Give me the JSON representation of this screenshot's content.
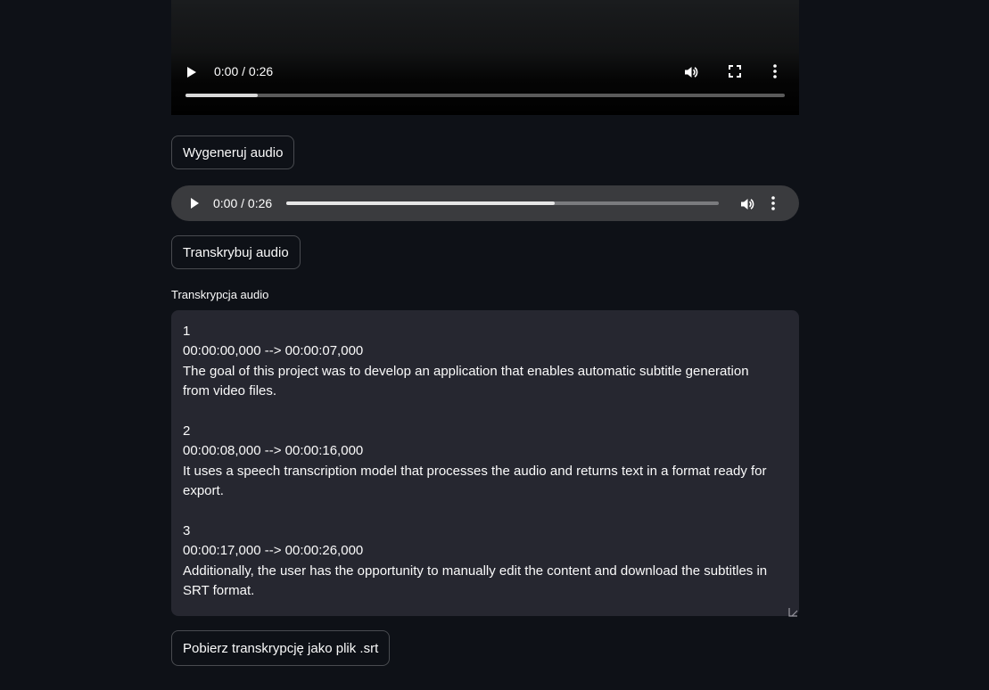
{
  "video_player": {
    "time": "0:00 / 0:26",
    "progress": 0.12
  },
  "generate_button": {
    "label": "Wygeneruj audio"
  },
  "audio_player": {
    "time": "0:00 / 0:26",
    "progress": 0.62
  },
  "transcribe_button": {
    "label": "Transkrybuj audio"
  },
  "transcription": {
    "label": "Transkrypcja audio",
    "value": "1\n00:00:00,000 --> 00:00:07,000\nThe goal of this project was to develop an application that enables automatic subtitle generation from video files.\n\n2\n00:00:08,000 --> 00:00:16,000\nIt uses a speech transcription model that processes the audio and returns text in a format ready for export.\n\n3\n00:00:17,000 --> 00:00:26,000\nAdditionally, the user has the opportunity to manually edit the content and download the subtitles in SRT format."
  },
  "download_button": {
    "label": "Pobierz transkrypcję jako plik .srt"
  },
  "icons": {
    "play": "play-icon",
    "volume": "volume-icon",
    "fullscreen": "fullscreen-icon",
    "more": "more-vertical-icon",
    "resize": "resize-handle-icon"
  },
  "colors": {
    "background": "#0e1117",
    "textarea_bg": "#262730",
    "audio_bg": "#3a3b3e",
    "text": "#fafafa"
  }
}
